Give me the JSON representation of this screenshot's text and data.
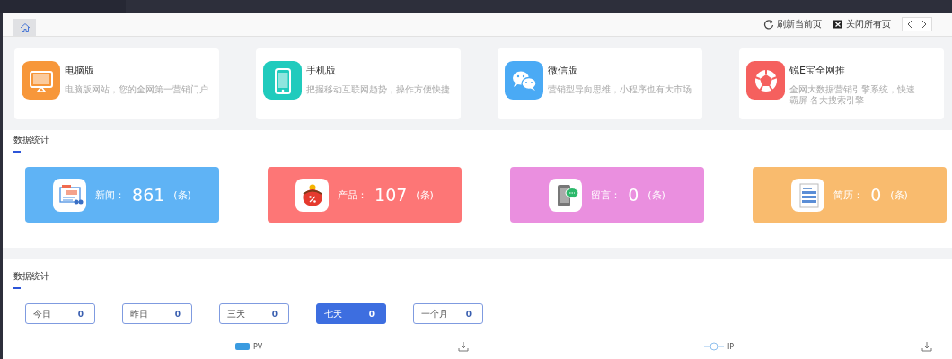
{
  "toolbar": {
    "actions": [
      {
        "kind": "refresh",
        "label": "刷新当前页"
      },
      {
        "kind": "close",
        "label": "关闭所有页"
      }
    ]
  },
  "platforms": [
    {
      "kind": "monitor",
      "title": "电脑版",
      "description": "电脑版网站，您的全网第一营销门户",
      "color": "#f7973a"
    },
    {
      "kind": "phone",
      "title": "手机版",
      "description": "把握移动互联网趋势，操作方便快捷",
      "color": "#20cbbd"
    },
    {
      "kind": "wechat",
      "title": "微信版",
      "description": "营销型导向思维，小程序也有大市场",
      "color": "#4aaaf5"
    },
    {
      "kind": "ball",
      "title": "锐E宝全网推",
      "description": "全网大数据营销引擎系统，快速霸屏 各大搜索引擎",
      "color": "#f5605e"
    }
  ],
  "stats": {
    "title": "数据统计",
    "items": [
      {
        "kind": "news",
        "label": "新闻：",
        "value": "861",
        "unit": "(条)",
        "color": "#5fb3f5"
      },
      {
        "kind": "product",
        "label": "产品：",
        "value": "107",
        "unit": "(条)",
        "color": "#fd7676"
      },
      {
        "kind": "message",
        "label": "留言：",
        "value": "0",
        "unit": "(条)",
        "color": "#ea8fdf"
      },
      {
        "kind": "resume",
        "label": "简历：",
        "value": "0",
        "unit": "(条)",
        "color": "#f9bb6e"
      }
    ]
  },
  "traffic": {
    "title": "数据统计",
    "periods": [
      {
        "label": "今日",
        "value": "0",
        "selected": false
      },
      {
        "label": "昨日",
        "value": "0",
        "selected": false
      },
      {
        "label": "三天",
        "value": "0",
        "selected": false
      },
      {
        "label": "七天",
        "value": "0",
        "selected": true
      },
      {
        "label": "一个月",
        "value": "0",
        "selected": false
      }
    ],
    "charts": [
      {
        "kind": "bar",
        "legend": "PV"
      },
      {
        "kind": "line",
        "legend": "IP"
      }
    ]
  }
}
